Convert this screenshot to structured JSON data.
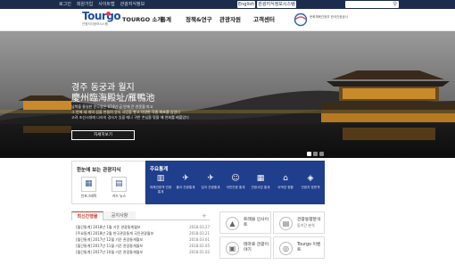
{
  "topbar": {
    "links": [
      "로그인",
      "회원가입",
      "사이트맵",
      "관광지식정보"
    ],
    "english_label": "English",
    "db_label": "관광지식정보시스템",
    "search_icon": "search-icon"
  },
  "nav": {
    "logo_text": "Tourgo",
    "logo_sub": "관광지식정보시스템",
    "menu": [
      "TOURGO 소개",
      "통계",
      "정책&연구",
      "관광자원",
      "고객센터"
    ],
    "partner_text": "문화체육관광부 한국관광공사"
  },
  "hero": {
    "title_ko": "경주 동궁과 월지",
    "title_hanja": "慶州臨海殿址/雁鴨池",
    "desc": [
      "남북을 통일한 문무왕은 674년 궁 안에 큰 연못을 파고",
      "그 안에 세 개의 섬을 만들며 못의 사방을 쌓고 다양한 각종 화초를 심었다",
      "고려 조선시대에 나라의 경사가 있을 때나 귀한 손님을 맞을 때 연회를 베풀었다"
    ],
    "button_label": "자세히보기",
    "slide_dots": 3,
    "active_dot": 0
  },
  "quick_panel": {
    "title": "한눈에 보는 관광지식",
    "items": [
      {
        "label": "인포그래픽",
        "icon": "infographic-icon",
        "glyph": "▦"
      },
      {
        "label": "카드 뉴스",
        "icon": "card-news-icon",
        "glyph": "▤"
      }
    ]
  },
  "stats": {
    "title": "주요통계",
    "items": [
      {
        "label": "외래관광객 관광통계",
        "icon": "chart-icon",
        "glyph": "▥"
      },
      {
        "label": "출국 관광통계",
        "icon": "airplane-icon",
        "glyph": "✈"
      },
      {
        "label": "입국 관광통계",
        "icon": "arrival-icon",
        "glyph": "✈"
      },
      {
        "label": "국민관광 통계",
        "icon": "people-icon",
        "glyph": "☺"
      },
      {
        "label": "관광사업 통계",
        "icon": "building-icon",
        "glyph": "▦"
      },
      {
        "label": "숙박업 현황",
        "icon": "hotel-icon",
        "glyph": "⌂"
      },
      {
        "label": "관광지 방문객",
        "icon": "map-icon",
        "glyph": "◈"
      }
    ]
  },
  "notice": {
    "tabs": [
      "최신간행물",
      "공지사항"
    ],
    "more_icon": "plus-icon",
    "rows": [
      {
        "title": "[월간통계] 2018년 1월 기준 관광통계월보",
        "date": "2018.03.27"
      },
      {
        "title": "[주요통계] 2018년 2월 한국관광통계 국민관광월보",
        "date": "2018.03.21"
      },
      {
        "title": "[월간통계] 2017년 12월 기준 관광통계월보",
        "date": "2018.03.01"
      },
      {
        "title": "[월간통계] 2017년 11월 기준 관광통계월보",
        "date": "2018.02.05"
      },
      {
        "title": "[월간통계] 2017년 10월 기준 관광통계월보",
        "date": "2018.01.02"
      }
    ]
  },
  "quick_boxes": [
    {
      "title": "트래블 인사이트",
      "sub": "",
      "icon": "insight-icon",
      "glyph": "▲"
    },
    {
      "title": "관광동향분석",
      "sub": "동기간 분석",
      "icon": "trend-icon",
      "glyph": "▤"
    },
    {
      "title": "테마로 관광이야기",
      "sub": "",
      "icon": "story-icon",
      "glyph": "▣"
    },
    {
      "title": "Tourgo 이벤트",
      "sub": "",
      "icon": "event-icon",
      "glyph": "◎"
    }
  ],
  "colors": {
    "topbar": "#1c2c4c",
    "stats_bg": "#1f3e8c",
    "accent_red": "#c0392b",
    "logo_blue": "#1e4e9c"
  }
}
